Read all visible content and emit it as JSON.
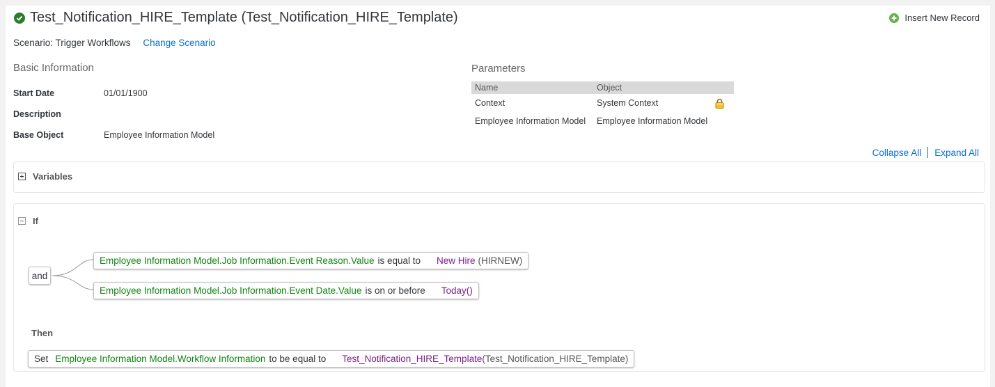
{
  "header": {
    "title": "Test_Notification_HIRE_Template (Test_Notification_HIRE_Template)",
    "insert_label": "Insert New Record"
  },
  "scenario": {
    "label": "Scenario: Trigger Workflows",
    "change_link": "Change Scenario"
  },
  "basic_info": {
    "heading": "Basic Information",
    "fields": [
      {
        "label": "Start Date",
        "value": "01/01/1900"
      },
      {
        "label": "Description",
        "value": ""
      },
      {
        "label": "Base Object",
        "value": "Employee Information Model"
      }
    ]
  },
  "parameters": {
    "heading": "Parameters",
    "columns": [
      "Name",
      "Object"
    ],
    "rows": [
      {
        "name": "Context",
        "object": "System Context",
        "locked": true
      },
      {
        "name": "Employee Information Model",
        "object": "Employee Information Model",
        "locked": false
      }
    ]
  },
  "controls": {
    "collapse_all": "Collapse All",
    "expand_all": "Expand All"
  },
  "variables": {
    "title": "Variables"
  },
  "rule": {
    "if_title": "If",
    "operator": "and",
    "conditions": [
      {
        "field": "Employee Information Model.Job Information.Event Reason.Value",
        "comparator": "is equal to",
        "value": "New Hire",
        "value_code": "(HIRNEW)"
      },
      {
        "field": "Employee Information Model.Job Information.Event Date.Value",
        "comparator": "is on or before",
        "value": "Today()"
      }
    ],
    "then_title": "Then",
    "action": {
      "verb": "Set",
      "target": "Employee Information Model.Workflow Information",
      "comparator": "to be equal to",
      "value": "Test_Notification_HIRE_Template",
      "value_code": "(Test_Notification_HIRE_Template)"
    }
  },
  "colors": {
    "link": "#0a6ed1",
    "field_green": "#108510",
    "value_purple": "#7a1e8a",
    "check_green": "#2b7c2b",
    "table_header": "#d9d9d9"
  },
  "icons": [
    "check-circle-icon",
    "add-circle-icon",
    "lock-icon",
    "expand-icon",
    "collapse-icon"
  ]
}
